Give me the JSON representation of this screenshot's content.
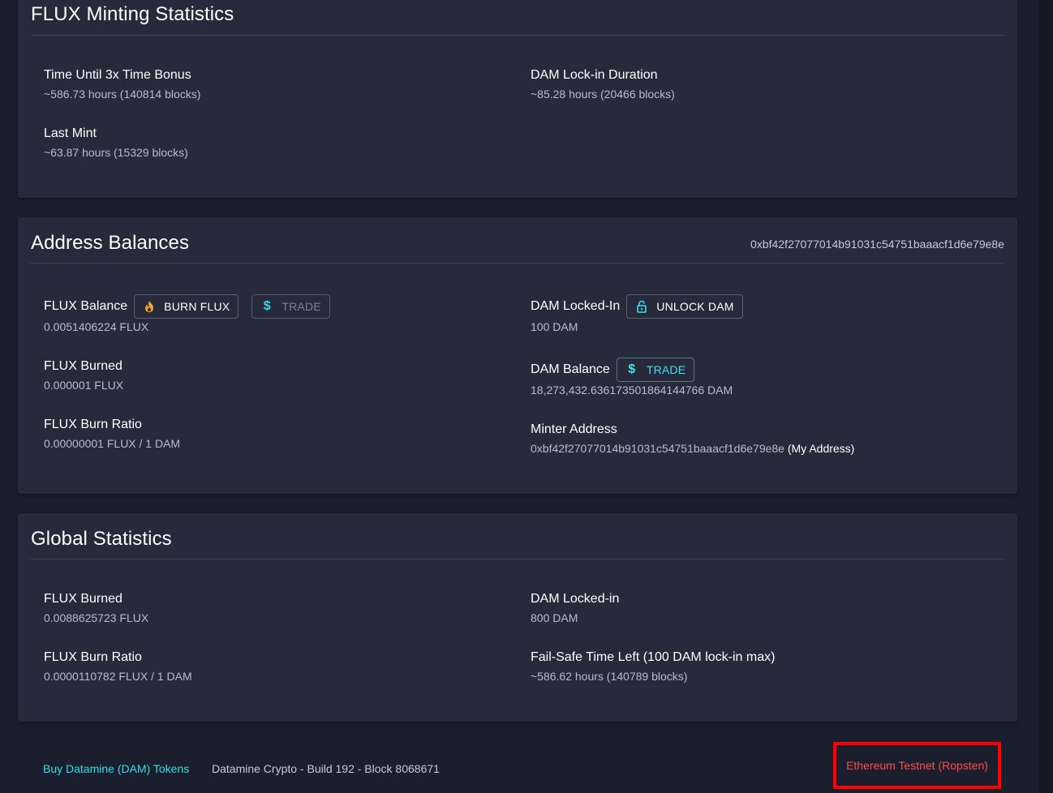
{
  "minting": {
    "title": "FLUX Minting Statistics",
    "time_bonus_label": "Time Until 3x Time Bonus",
    "time_bonus_value": "~586.73 hours (140814 blocks)",
    "lockin_duration_label": "DAM Lock-in Duration",
    "lockin_duration_value": "~85.28 hours (20466 blocks)",
    "last_mint_label": "Last Mint",
    "last_mint_value": "~63.87 hours (15329 blocks)"
  },
  "balances": {
    "title": "Address Balances",
    "address": "0xbf42f27077014b91031c54751baaacf1d6e79e8e",
    "flux_balance_label": "FLUX Balance",
    "burn_flux_label": "BURN FLUX",
    "trade_label": "TRADE",
    "flux_balance_value": "0.0051406224 FLUX",
    "flux_burned_label": "FLUX Burned",
    "flux_burned_value": "0.000001 FLUX",
    "flux_burn_ratio_label": "FLUX Burn Ratio",
    "flux_burn_ratio_value": "0.00000001 FLUX / 1 DAM",
    "dam_locked_label": "DAM Locked-In",
    "unlock_dam_label": "UNLOCK DAM",
    "dam_locked_value": "100 DAM",
    "dam_balance_label": "DAM Balance",
    "dam_trade_label": "TRADE",
    "dam_balance_value": "18,273,432.636173501864144766 DAM",
    "minter_address_label": "Minter Address",
    "minter_address_value": "0xbf42f27077014b91031c54751baaacf1d6e79e8e",
    "my_address_label": "(My Address)"
  },
  "global": {
    "title": "Global Statistics",
    "flux_burned_label": "FLUX Burned",
    "flux_burned_value": "0.0088625723 FLUX",
    "flux_burn_ratio_label": "FLUX Burn Ratio",
    "flux_burn_ratio_value": "0.0000110782 FLUX / 1 DAM",
    "dam_locked_label": "DAM Locked-in",
    "dam_locked_value": "800 DAM",
    "failsafe_label": "Fail-Safe Time Left (100 DAM lock-in max)",
    "failsafe_value": "~586.62 hours (140789 blocks)"
  },
  "footer": {
    "buy_link": "Buy Datamine (DAM) Tokens",
    "build_info": "Datamine Crypto - Build 192 - Block 8068671",
    "network": "Ethereum Testnet (Ropsten)"
  },
  "icons": {
    "burn": "fire-icon",
    "trade": "dollar-icon",
    "unlock": "lock-open-icon"
  },
  "colors": {
    "accent_cyan": "#3fe3ef",
    "fire_orange": "#f5a623",
    "network_red": "#ff4b4b",
    "highlight_border": "#ff0000"
  }
}
